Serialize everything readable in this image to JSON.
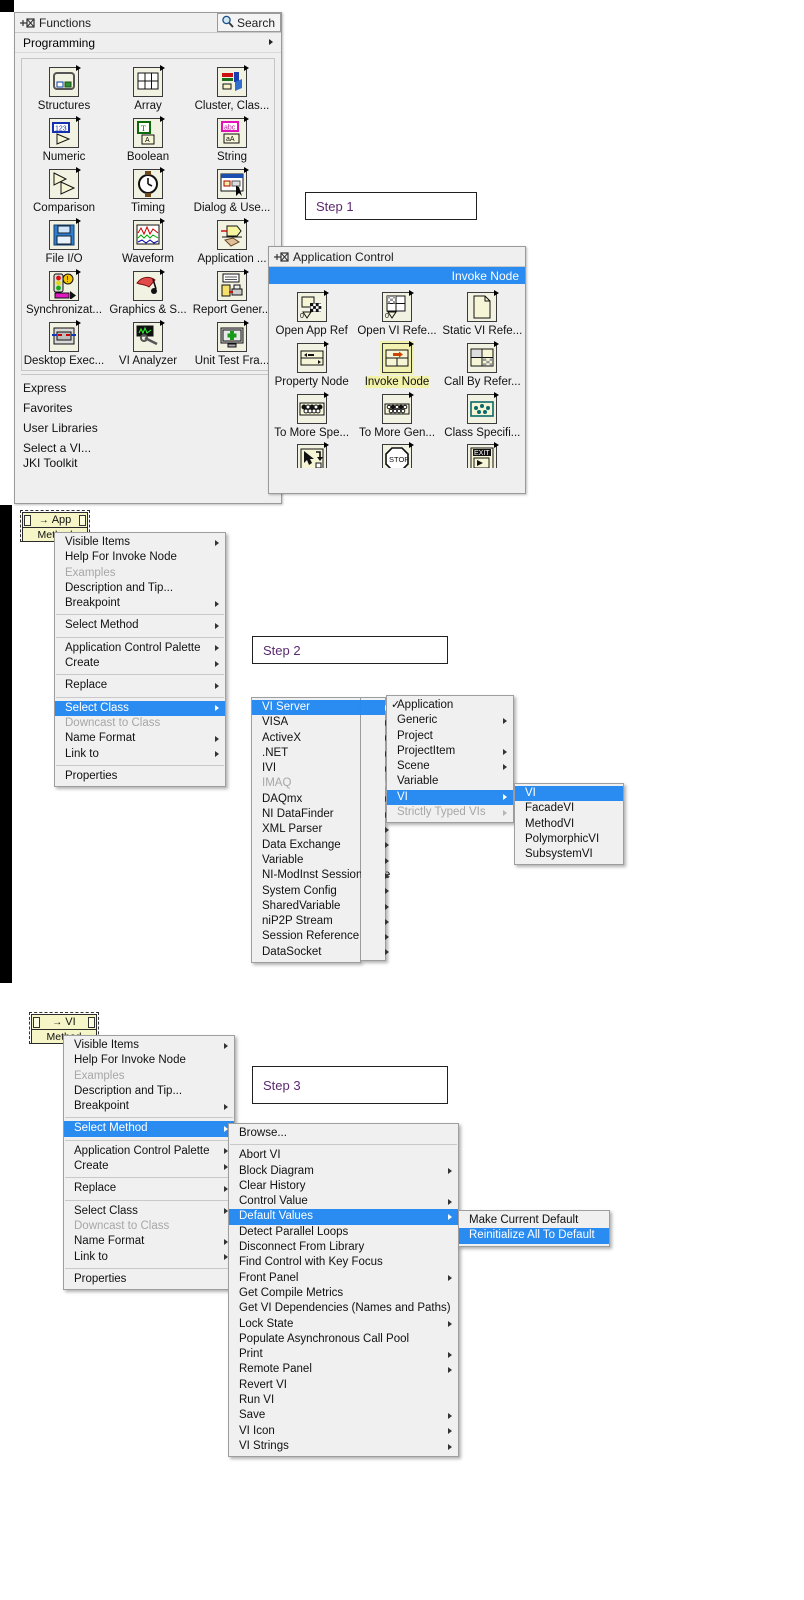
{
  "functions_palette": {
    "title": "Functions",
    "pin_icon": "pin-icon",
    "search_label": "Search",
    "search_icon": "search-icon",
    "breadcrumb": "Programming",
    "items": [
      {
        "label": "Structures",
        "icon": "structures-icon"
      },
      {
        "label": "Array",
        "icon": "array-icon"
      },
      {
        "label": "Cluster, Clas...",
        "icon": "cluster-class-icon"
      },
      {
        "label": "Numeric",
        "icon": "numeric-icon"
      },
      {
        "label": "Boolean",
        "icon": "boolean-icon"
      },
      {
        "label": "String",
        "icon": "string-icon"
      },
      {
        "label": "Comparison",
        "icon": "comparison-icon"
      },
      {
        "label": "Timing",
        "icon": "timing-icon"
      },
      {
        "label": "Dialog & Use...",
        "icon": "dialog-user-icon"
      },
      {
        "label": "File I/O",
        "icon": "file-io-icon"
      },
      {
        "label": "Waveform",
        "icon": "waveform-icon"
      },
      {
        "label": "Application ...",
        "icon": "application-control-icon"
      },
      {
        "label": "Synchronizat...",
        "icon": "synchronization-icon"
      },
      {
        "label": "Graphics & S...",
        "icon": "graphics-sound-icon"
      },
      {
        "label": "Report Gener...",
        "icon": "report-generation-icon"
      },
      {
        "label": "Desktop Exec...",
        "icon": "desktop-execution-icon"
      },
      {
        "label": "VI Analyzer",
        "icon": "vi-analyzer-icon"
      },
      {
        "label": "Unit Test Fra...",
        "icon": "unit-test-framework-icon"
      }
    ],
    "lists": [
      "Express",
      "Favorites",
      "User Libraries",
      "Select a VI..."
    ],
    "clipped_list_item": "JKI Toolkit"
  },
  "app_control_palette": {
    "title": "Application Control",
    "pin_icon": "pin-icon",
    "selected_banner": "Invoke Node",
    "items": [
      {
        "label": "Open App Ref",
        "icon": "open-application-reference-icon",
        "highlighted": false
      },
      {
        "label": "Open VI Refe...",
        "icon": "open-vi-reference-icon",
        "highlighted": false
      },
      {
        "label": "Static VI Refe...",
        "icon": "static-vi-reference-icon",
        "highlighted": false
      },
      {
        "label": "Property Node",
        "icon": "property-node-icon",
        "highlighted": false
      },
      {
        "label": "Invoke Node",
        "icon": "invoke-node-icon",
        "highlighted": true
      },
      {
        "label": "Call By Refer...",
        "icon": "call-by-reference-icon",
        "highlighted": false
      },
      {
        "label": "To More Spe...",
        "icon": "to-more-specific-class-icon",
        "highlighted": false
      },
      {
        "label": "To More Gen...",
        "icon": "to-more-generic-class-icon",
        "highlighted": false
      },
      {
        "label": "Class Specifi...",
        "icon": "class-specifier-constant-icon",
        "highlighted": false
      }
    ],
    "row4_icons": [
      "cursor-icon",
      "stop-icon",
      "exit-icon"
    ]
  },
  "steps": {
    "step1": "Step 1",
    "step2": "Step 2",
    "step3": "Step 3"
  },
  "step2": {
    "node": {
      "top": "App",
      "bottom": "Method"
    },
    "context_menu": [
      {
        "label": "Visible Items",
        "sub": true,
        "disabled": false,
        "selected": false
      },
      {
        "label": "Help For Invoke Node",
        "sub": false,
        "disabled": false,
        "selected": false
      },
      {
        "label": "Examples",
        "sub": false,
        "disabled": true,
        "selected": false
      },
      {
        "label": "Description and Tip...",
        "sub": false,
        "disabled": false,
        "selected": false
      },
      {
        "label": "Breakpoint",
        "sub": true,
        "disabled": false,
        "selected": false
      },
      {
        "sep": true
      },
      {
        "label": "Select Method",
        "sub": true,
        "disabled": false,
        "selected": false
      },
      {
        "sep": true
      },
      {
        "label": "Application Control Palette",
        "sub": true,
        "disabled": false,
        "selected": false
      },
      {
        "label": "Create",
        "sub": true,
        "disabled": false,
        "selected": false
      },
      {
        "sep": true
      },
      {
        "label": "Replace",
        "sub": true,
        "disabled": false,
        "selected": false
      },
      {
        "sep": true
      },
      {
        "label": "Select Class",
        "sub": true,
        "disabled": false,
        "selected": true
      },
      {
        "label": "Downcast to Class",
        "sub": false,
        "disabled": true,
        "selected": false
      },
      {
        "label": "Name Format",
        "sub": true,
        "disabled": false,
        "selected": false
      },
      {
        "label": "Link to",
        "sub": true,
        "disabled": false,
        "selected": false
      },
      {
        "sep": true
      },
      {
        "label": "Properties",
        "sub": false,
        "disabled": false,
        "selected": false
      }
    ],
    "select_class_menu": [
      {
        "label": "VI Server",
        "sub": true,
        "disabled": false,
        "selected": true
      },
      {
        "label": "VISA",
        "sub": true,
        "disabled": false,
        "selected": false
      },
      {
        "label": "ActiveX",
        "sub": true,
        "disabled": false,
        "selected": false
      },
      {
        "label": ".NET",
        "sub": true,
        "disabled": false,
        "selected": false
      },
      {
        "label": "IVI",
        "sub": true,
        "disabled": false,
        "selected": false
      },
      {
        "label": "IMAQ",
        "sub": true,
        "disabled": true,
        "selected": false
      },
      {
        "label": "DAQmx",
        "sub": true,
        "disabled": false,
        "selected": false
      },
      {
        "label": "NI DataFinder",
        "sub": true,
        "disabled": false,
        "selected": false
      },
      {
        "label": "XML Parser",
        "sub": true,
        "disabled": false,
        "selected": false
      },
      {
        "label": "Data Exchange",
        "sub": true,
        "disabled": false,
        "selected": false
      },
      {
        "label": "Variable",
        "sub": true,
        "disabled": false,
        "selected": false
      },
      {
        "label": "NI-ModInst Session Type",
        "sub": true,
        "disabled": false,
        "selected": false
      },
      {
        "label": "System Config",
        "sub": true,
        "disabled": false,
        "selected": false
      },
      {
        "label": "SharedVariable",
        "sub": true,
        "disabled": false,
        "selected": false
      },
      {
        "label": "niP2P Stream",
        "sub": true,
        "disabled": false,
        "selected": false
      },
      {
        "label": "Session Reference",
        "sub": true,
        "disabled": false,
        "selected": false
      },
      {
        "label": "DataSocket",
        "sub": true,
        "disabled": false,
        "selected": false
      }
    ],
    "vi_server_menu": [
      {
        "label": "Application",
        "sub": false,
        "disabled": false,
        "selected": false,
        "checked": true
      },
      {
        "label": "Generic",
        "sub": true,
        "disabled": false,
        "selected": false,
        "checked": false
      },
      {
        "label": "Project",
        "sub": false,
        "disabled": false,
        "selected": false,
        "checked": false
      },
      {
        "label": "ProjectItem",
        "sub": true,
        "disabled": false,
        "selected": false,
        "checked": false
      },
      {
        "label": "Scene",
        "sub": true,
        "disabled": false,
        "selected": false,
        "checked": false
      },
      {
        "label": "Variable",
        "sub": false,
        "disabled": false,
        "selected": false,
        "checked": false
      },
      {
        "label": "VI",
        "sub": true,
        "disabled": false,
        "selected": true,
        "checked": false
      },
      {
        "label": "Strictly Typed VIs",
        "sub": true,
        "disabled": true,
        "selected": false,
        "checked": false
      }
    ],
    "vi_menu": [
      {
        "label": "VI",
        "selected": true
      },
      {
        "label": "FacadeVI",
        "selected": false
      },
      {
        "label": "MethodVI",
        "selected": false
      },
      {
        "label": "PolymorphicVI",
        "selected": false
      },
      {
        "label": "SubsystemVI",
        "selected": false
      }
    ]
  },
  "step3": {
    "node": {
      "top": "VI",
      "bottom": "Method"
    },
    "context_menu": [
      {
        "label": "Visible Items",
        "sub": true,
        "disabled": false,
        "selected": false
      },
      {
        "label": "Help For Invoke Node",
        "sub": false,
        "disabled": false,
        "selected": false
      },
      {
        "label": "Examples",
        "sub": false,
        "disabled": true,
        "selected": false
      },
      {
        "label": "Description and Tip...",
        "sub": false,
        "disabled": false,
        "selected": false
      },
      {
        "label": "Breakpoint",
        "sub": true,
        "disabled": false,
        "selected": false
      },
      {
        "sep": true
      },
      {
        "label": "Select Method",
        "sub": true,
        "disabled": false,
        "selected": true
      },
      {
        "sep": true
      },
      {
        "label": "Application Control Palette",
        "sub": true,
        "disabled": false,
        "selected": false
      },
      {
        "label": "Create",
        "sub": true,
        "disabled": false,
        "selected": false
      },
      {
        "sep": true
      },
      {
        "label": "Replace",
        "sub": true,
        "disabled": false,
        "selected": false
      },
      {
        "sep": true
      },
      {
        "label": "Select Class",
        "sub": true,
        "disabled": false,
        "selected": false
      },
      {
        "label": "Downcast to Class",
        "sub": false,
        "disabled": true,
        "selected": false
      },
      {
        "label": "Name Format",
        "sub": true,
        "disabled": false,
        "selected": false
      },
      {
        "label": "Link to",
        "sub": true,
        "disabled": false,
        "selected": false
      },
      {
        "sep": true
      },
      {
        "label": "Properties",
        "sub": false,
        "disabled": false,
        "selected": false
      }
    ],
    "select_method_menu": [
      {
        "label": "Browse...",
        "sub": false,
        "disabled": false,
        "selected": false
      },
      {
        "sep": true
      },
      {
        "label": "Abort VI",
        "sub": false,
        "disabled": false,
        "selected": false
      },
      {
        "label": "Block Diagram",
        "sub": true,
        "disabled": false,
        "selected": false
      },
      {
        "label": "Clear History",
        "sub": false,
        "disabled": false,
        "selected": false
      },
      {
        "label": "Control Value",
        "sub": true,
        "disabled": false,
        "selected": false
      },
      {
        "label": "Default Values",
        "sub": true,
        "disabled": false,
        "selected": true
      },
      {
        "label": "Detect Parallel Loops",
        "sub": false,
        "disabled": false,
        "selected": false
      },
      {
        "label": "Disconnect From Library",
        "sub": false,
        "disabled": false,
        "selected": false
      },
      {
        "label": "Find Control with Key Focus",
        "sub": false,
        "disabled": false,
        "selected": false
      },
      {
        "label": "Front Panel",
        "sub": true,
        "disabled": false,
        "selected": false
      },
      {
        "label": "Get Compile Metrics",
        "sub": false,
        "disabled": false,
        "selected": false
      },
      {
        "label": "Get VI Dependencies (Names and Paths)",
        "sub": false,
        "disabled": false,
        "selected": false
      },
      {
        "label": "Lock State",
        "sub": true,
        "disabled": false,
        "selected": false
      },
      {
        "label": "Populate Asynchronous Call Pool",
        "sub": false,
        "disabled": false,
        "selected": false
      },
      {
        "label": "Print",
        "sub": true,
        "disabled": false,
        "selected": false
      },
      {
        "label": "Remote Panel",
        "sub": true,
        "disabled": false,
        "selected": false
      },
      {
        "label": "Revert VI",
        "sub": false,
        "disabled": false,
        "selected": false
      },
      {
        "label": "Run VI",
        "sub": false,
        "disabled": false,
        "selected": false
      },
      {
        "label": "Save",
        "sub": true,
        "disabled": false,
        "selected": false
      },
      {
        "label": "VI Icon",
        "sub": true,
        "disabled": false,
        "selected": false
      },
      {
        "label": "VI Strings",
        "sub": true,
        "disabled": false,
        "selected": false
      }
    ],
    "default_values_menu": [
      {
        "label": "Make Current Default",
        "selected": false
      },
      {
        "label": "Reinitialize All To Default",
        "selected": true
      }
    ]
  },
  "colors": {
    "menu_highlight": "#2a8bf0",
    "menu_bg": "#f0f0f0",
    "palette_bg": "#efefef",
    "node_yellow": "#f5f5c8",
    "highlight_yellow": "#f2f2a8",
    "step_text": "#5b2a6e"
  }
}
